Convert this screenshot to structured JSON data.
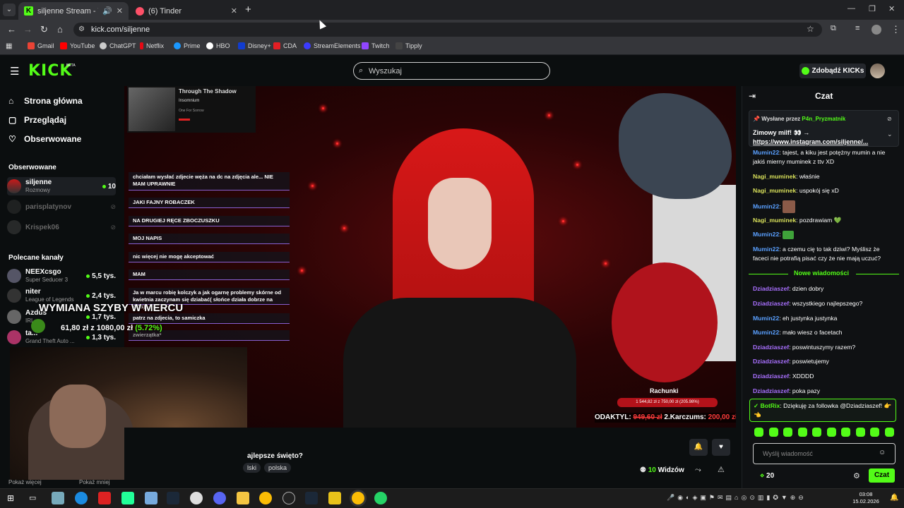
{
  "browser": {
    "tabs": [
      {
        "title": "siljenne Stream - Watch Li..."
      },
      {
        "title": "(6) Tinder"
      }
    ],
    "url": "kick.com/siljenne",
    "bookmarks": [
      "Gmail",
      "YouTube",
      "ChatGPT",
      "Netflix",
      "Prime",
      "HBO",
      "Disney+",
      "CDA",
      "StreamElements",
      "Twitch",
      "Tipply"
    ]
  },
  "header": {
    "logo": "KICK",
    "beta": "BETA",
    "search_placeholder": "Wyszukaj",
    "get_kicks": "Zdobądź KICKs"
  },
  "sidebar": {
    "nav": [
      {
        "label": "Strona główna",
        "icon": "home-icon"
      },
      {
        "label": "Przeglądaj",
        "icon": "browse-icon"
      },
      {
        "label": "Obserwowane",
        "icon": "heart-icon"
      }
    ],
    "followed_heading": "Obserwowane",
    "followed": [
      {
        "name": "siljenne",
        "category": "Rozmowy",
        "viewers": "10",
        "live": true
      },
      {
        "name": "parisplatynov",
        "live": false
      },
      {
        "name": "Krispek06",
        "live": false
      }
    ],
    "recommended_heading": "Polecane kanały",
    "recommended": [
      {
        "name": "NEEXcsgo",
        "category": "Super Seducer 3",
        "viewers": "5,5 tys."
      },
      {
        "name": "niter",
        "category": "League of Legends",
        "viewers": "2,4 tys."
      },
      {
        "name": "Azdus",
        "category": "IRL",
        "viewers": "1,7 tys."
      },
      {
        "name": "ta...",
        "category": "Grand Theft Auto ...",
        "viewers": "1,3 tys."
      }
    ],
    "show_more": "Pokaż więcej",
    "show_less": "Pokaż mniej"
  },
  "overlay": {
    "album_title": "Through The Shadow",
    "album_artist": "Insomnium",
    "album_sub": "One For Sorrow",
    "chat": [
      "chciałam wysłać zdjecie węża na dc na zdjęcia ale... NIE MAM UPRAWNIE",
      "JAKI FAJNY ROBACZEK",
      "NA DRUGIEJ RĘCE ZBOCZUSZKU",
      "MOJ NAPIS",
      "nic więcej nie mogę akceptować",
      "MAM",
      "Ja w marcu robię kolczyk a jak ogarnę problemy skórne od kwietnia zaczynam się dziabać( słońce działa dobrze na AZS)",
      "patrz na zdjecia, to samiczka",
      "zwierzątka*"
    ],
    "donation_text": "WYMIANA SZYBY W MERCU",
    "donation_amount": "61,80 zł z 1080,00 zł",
    "donation_percent": "(5.72%)",
    "bill_title": "Rachunki",
    "bill_bar": "1 544,82 zł z 750,00 zł (205.98%)",
    "ticker_a": "ODAKTYL:",
    "ticker_b": "949,60 zł",
    "ticker_c": "2.Karczums:",
    "ticker_d": "200,00 zł"
  },
  "stream": {
    "title_partial": "ajlepsze święto?",
    "tags": [
      "lski",
      "polska"
    ],
    "viewers_count": "10",
    "viewers_label": "Widzów"
  },
  "chat": {
    "title": "Czat",
    "pinned_by_label": "Wysłane przez",
    "pinned_by": "P4n_Pryzmatnik",
    "pinned_text": "Zimowy milf! 👀 →",
    "pinned_link": "https://www.instagram.com/siljenne/...",
    "messages": [
      {
        "user": "Mumin22",
        "color": "blue",
        "text": "tajest, a kiku jest potężny mumin a nie jakiś mierny muminek z ttv XD"
      },
      {
        "user": "Nagi_muminek",
        "color": "yellow",
        "text": "właśnie"
      },
      {
        "user": "Nagi_muminek",
        "color": "yellow",
        "text": "uspokój się xD"
      },
      {
        "user": "Mumin22",
        "color": "blue",
        "text": ""
      },
      {
        "user": "Nagi_muminek",
        "color": "yellow",
        "text": "pozdrawiam 💚"
      },
      {
        "user": "Mumin22",
        "color": "blue",
        "text": ""
      },
      {
        "user": "Mumin22",
        "color": "blue",
        "text": "a czemu cię to tak dziwi? Myślisz że faceci nie potrafią pisać czy że nie mają uczuć?"
      }
    ],
    "new_messages": "Nowe wiadomości",
    "messages_after": [
      {
        "user": "Dziadziaszef",
        "color": "purple",
        "text": "dzien dobry"
      },
      {
        "user": "Dziadziaszef",
        "color": "purple",
        "text": "wszystkiego najlepszego?"
      },
      {
        "user": "Mumin22",
        "color": "blue",
        "text": "eh justynka justynka"
      },
      {
        "user": "Mumin22",
        "color": "blue",
        "text": "mało wiesz o facetach"
      },
      {
        "user": "Dziadziaszef",
        "color": "purple",
        "text": "poswintuszymy razem?"
      },
      {
        "user": "Dziadziaszef",
        "color": "purple",
        "text": "poswietujemy"
      },
      {
        "user": "Dziadziaszef",
        "color": "purple",
        "text": "XDDDD"
      },
      {
        "user": "Dziadziaszef",
        "color": "purple",
        "text": "poka pazy"
      }
    ],
    "bot_user": "BotRix",
    "bot_text": "Dziękuję za followka @Dziadziaszef! 👉👈",
    "input_placeholder": "Wyślij wiadomość",
    "points": "20",
    "send_label": "Czat"
  },
  "taskbar": {
    "time": "03:08",
    "date": "15.02.2026"
  }
}
